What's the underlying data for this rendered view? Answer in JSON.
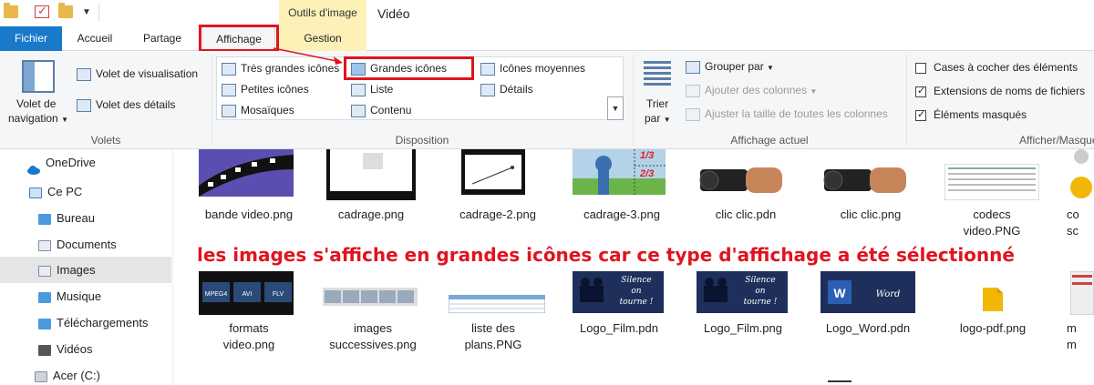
{
  "window": {
    "title": "Vidéo"
  },
  "ribbon_tabs": {
    "fichier": "Fichier",
    "accueil": "Accueil",
    "partage": "Partage",
    "affichage": "Affichage",
    "contextual_group": "Outils d'image",
    "gestion": "Gestion"
  },
  "volets_group": {
    "label": "Volets",
    "navigation_pane_line1": "Volet de",
    "navigation_pane_line2": "navigation",
    "preview_pane": "Volet de visualisation",
    "details_pane": "Volet des détails"
  },
  "layout_group": {
    "label": "Disposition",
    "options": {
      "tres_grandes_icones": "Très grandes icônes",
      "grandes_icones": "Grandes icônes",
      "icones_moyennes": "Icônes moyennes",
      "petites_icones": "Petites icônes",
      "liste": "Liste",
      "details": "Détails",
      "mosaiques": "Mosaïques",
      "contenu": "Contenu"
    },
    "selected": "Grandes icônes"
  },
  "current_view_group": {
    "label": "Affichage actuel",
    "sort_line1": "Trier",
    "sort_line2": "par",
    "group_by": "Grouper par",
    "add_columns": "Ajouter des colonnes",
    "fit_columns": "Ajuster la taille de toutes les colonnes"
  },
  "show_hide_group": {
    "label": "Afficher/Masquer",
    "item_checkboxes": {
      "label": "Cases à cocher des éléments",
      "checked": false
    },
    "file_extensions": {
      "label": "Extensions de noms de fichiers",
      "checked": true
    },
    "hidden_items": {
      "label": "Éléments masqués",
      "checked": true
    }
  },
  "navigation": {
    "items": [
      {
        "label": "OneDrive",
        "icon": "cloud-icon",
        "selected": false
      },
      {
        "label": "Ce PC",
        "icon": "computer-icon",
        "selected": false
      },
      {
        "label": "Bureau",
        "icon": "desktop-folder-icon",
        "selected": false
      },
      {
        "label": "Documents",
        "icon": "documents-folder-icon",
        "selected": false
      },
      {
        "label": "Images",
        "icon": "pictures-folder-icon",
        "selected": true
      },
      {
        "label": "Musique",
        "icon": "music-folder-icon",
        "selected": false
      },
      {
        "label": "Téléchargements",
        "icon": "downloads-folder-icon",
        "selected": false
      },
      {
        "label": "Vidéos",
        "icon": "videos-folder-icon",
        "selected": false
      },
      {
        "label": "Acer (C:)",
        "icon": "drive-icon",
        "selected": false
      }
    ]
  },
  "files_row1": [
    {
      "line1": "bande video.png",
      "line2": ""
    },
    {
      "line1": "cadrage.png",
      "line2": ""
    },
    {
      "line1": "cadrage-2.png",
      "line2": ""
    },
    {
      "line1": "cadrage-3.png",
      "line2": ""
    },
    {
      "line1": "clic clic.pdn",
      "line2": ""
    },
    {
      "line1": "clic clic.png",
      "line2": ""
    },
    {
      "line1": "codecs",
      "line2": "video.PNG"
    },
    {
      "line1": "co",
      "line2": "sc"
    }
  ],
  "files_row2": [
    {
      "line1": "formats",
      "line2": "video.png"
    },
    {
      "line1": "images",
      "line2": "successives.png"
    },
    {
      "line1": "liste des",
      "line2": "plans.PNG"
    },
    {
      "line1": "Logo_Film.pdn",
      "line2": ""
    },
    {
      "line1": "Logo_Film.png",
      "line2": ""
    },
    {
      "line1": "Logo_Word.pdn",
      "line2": ""
    },
    {
      "line1": "logo-pdf.png",
      "line2": ""
    },
    {
      "line1": "m",
      "line2": "m"
    }
  ],
  "thumb_text": {
    "fraction_top": "1/3",
    "fraction_bottom": "2/3",
    "silence_1": "Silence",
    "silence_2": "on",
    "silence_3": "tourne !",
    "word": "Word",
    "formats": [
      "MPEG4",
      "AVI",
      "FLV"
    ]
  },
  "annotation": "les images s'affiche en grandes icônes car ce type d'affichage a été sélectionné",
  "colors": {
    "accent": "#1979ca",
    "context_tab": "#fdf1b8",
    "highlight_red": "#e0141e",
    "selected_nav": "#e5e5e5"
  }
}
